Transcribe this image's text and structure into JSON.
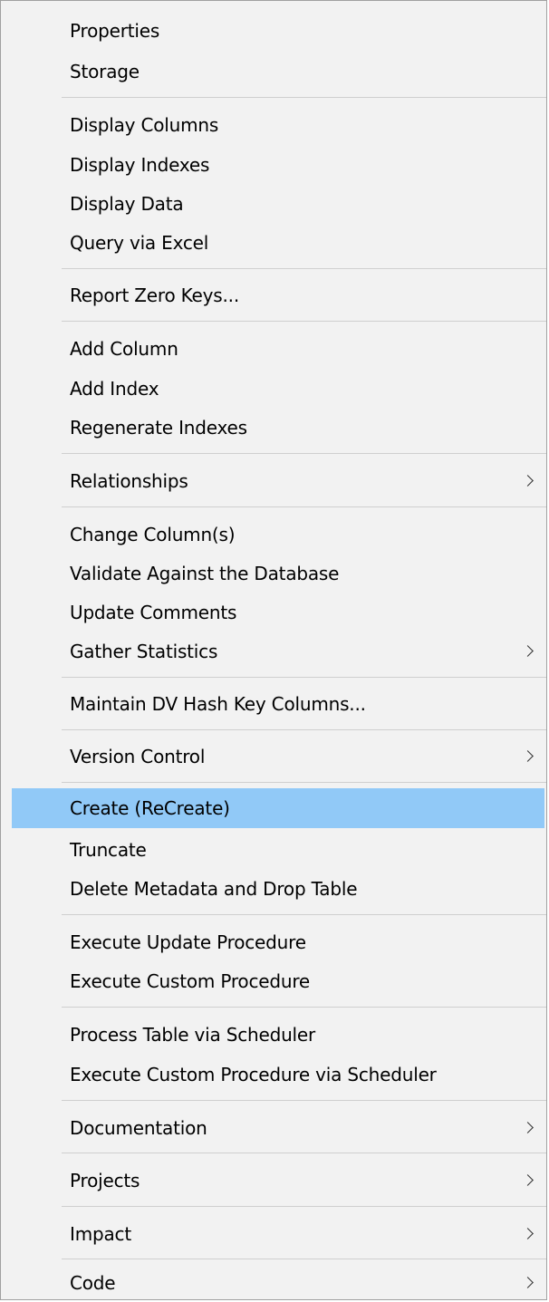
{
  "menu": {
    "highlight_color": "#91c9f7",
    "background_color": "#f2f2f2",
    "items": {
      "properties": "Properties",
      "storage": "Storage",
      "display_columns": "Display Columns",
      "display_indexes": "Display Indexes",
      "display_data": "Display Data",
      "query_via_excel": "Query via Excel",
      "report_zero_keys": "Report Zero Keys...",
      "add_column": "Add Column",
      "add_index": "Add Index",
      "regenerate_indexes": "Regenerate Indexes",
      "relationships": "Relationships",
      "change_columns": "Change Column(s)",
      "validate_against_database": "Validate Against the Database",
      "update_comments": "Update Comments",
      "gather_statistics": "Gather Statistics",
      "maintain_dv_hash_key_columns": "Maintain DV Hash Key Columns...",
      "version_control": "Version Control",
      "create_recreate": "Create (ReCreate)",
      "truncate": "Truncate",
      "delete_metadata_drop_table": "Delete Metadata and Drop Table",
      "execute_update_procedure": "Execute Update Procedure",
      "execute_custom_procedure": "Execute Custom Procedure",
      "process_table_via_scheduler": "Process Table via Scheduler",
      "execute_custom_procedure_via_scheduler": "Execute Custom Procedure via Scheduler",
      "documentation": "Documentation",
      "projects": "Projects",
      "impact": "Impact",
      "code": "Code"
    },
    "highlighted_item": "Create (ReCreate)",
    "submenu_arrow_icon": "chevron-right-icon"
  }
}
